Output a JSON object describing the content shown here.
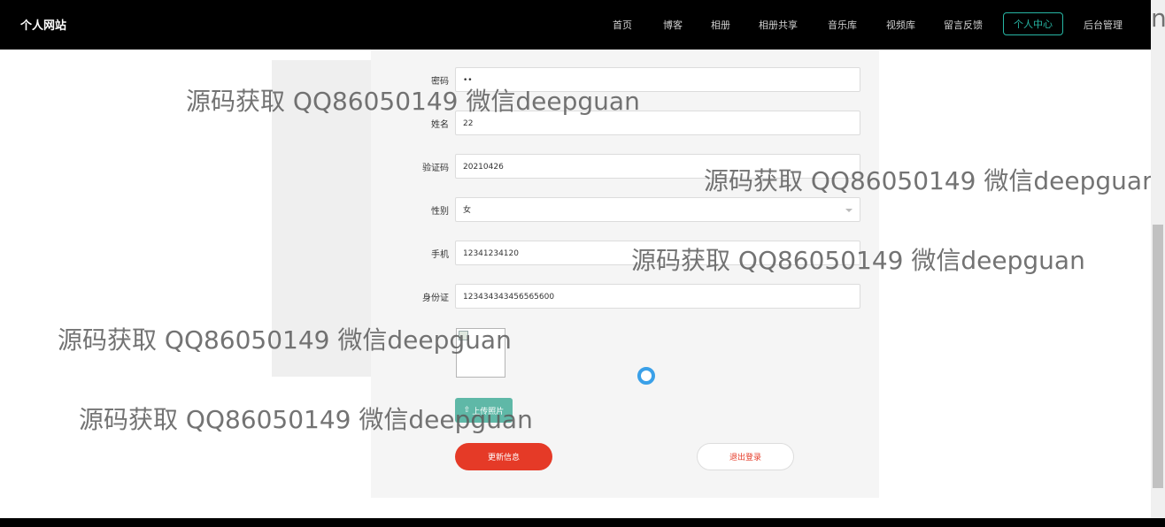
{
  "header": {
    "brand": "个人网站",
    "nav": [
      "首页",
      "博客",
      "相册",
      "相册共享",
      "音乐库",
      "视频库",
      "留言反馈",
      "个人中心",
      "后台管理"
    ],
    "active_nav": "个人中心"
  },
  "form": {
    "fields": [
      {
        "label": "密码",
        "value": "••"
      },
      {
        "label": "姓名",
        "value": "22"
      },
      {
        "label": "验证码",
        "value": "20210426"
      },
      {
        "label": "性别",
        "value": "女"
      },
      {
        "label": "手机",
        "value": "12341234120"
      },
      {
        "label": "身份证",
        "value": "123434343456565600"
      }
    ],
    "upload_label": "上传照片",
    "update_label": "更新信息",
    "logout_label": "退出登录"
  },
  "watermarks": [
    "源码获取 QQ86050149 微信deepguan",
    "源码获取 QQ86050149 微信deepguan",
    "源码获取 QQ86050149 微信deepguan",
    "源码获取 QQ86050149 微信deepguan",
    "源码获取 QQ86050149 微信deepguan"
  ],
  "edge_glyph": "n",
  "colors": {
    "accent": "#27b6a4",
    "primary_button": "#e53a27",
    "upload_button": "#5fb8a7",
    "spinner": "#3aa0e8"
  }
}
